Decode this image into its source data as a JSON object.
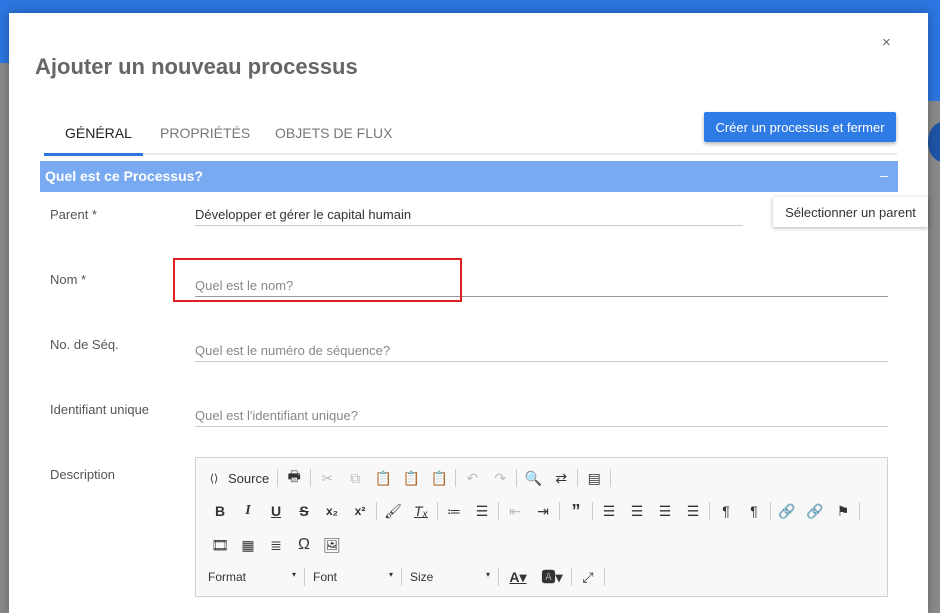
{
  "modal": {
    "title": "Ajouter un nouveau processus",
    "close": "×"
  },
  "tabs": [
    {
      "label": "GÉNÉRAL"
    },
    {
      "label": "PROPRIÉTÉS"
    },
    {
      "label": "OBJETS DE FLUX"
    }
  ],
  "create_button": "Créer un processus et fermer",
  "section": {
    "title": "Quel est ce Processus?",
    "toggle": "–"
  },
  "fields": {
    "parent": {
      "label": "Parent  *",
      "value": "Développer et gérer le capital humain",
      "button": "Sélectionner un parent"
    },
    "nom": {
      "label": "Nom *",
      "placeholder": "Quel est le nom?"
    },
    "seq": {
      "label": "No. de Séq.",
      "placeholder": "Quel est le numéro de séquence?"
    },
    "uid": {
      "label": "Identifiant unique",
      "placeholder": "Quel est l'identifiant unique?"
    },
    "description": {
      "label": "Description"
    }
  },
  "editor": {
    "source": "Source",
    "format": "Format",
    "font": "Font",
    "size": "Size",
    "arrow": "▾"
  }
}
